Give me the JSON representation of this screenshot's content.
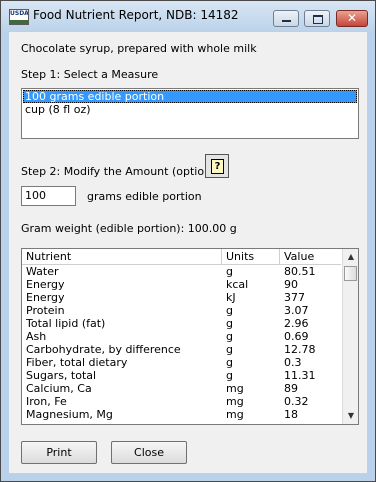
{
  "window": {
    "title": "Food Nutrient Report, NDB: 14182",
    "icon_label": "USDA",
    "controls": {
      "minimize_icon": "minimize-icon",
      "maximize_icon": "maximize-icon",
      "close_glyph": "✕"
    }
  },
  "food_description": "Chocolate syrup, prepared with whole milk",
  "step1": {
    "label": "Step 1: Select a Measure",
    "measures": [
      {
        "label": "100 grams edible portion",
        "selected": true
      },
      {
        "label": "cup (8 fl oz)",
        "selected": false
      }
    ]
  },
  "step2": {
    "label": "Step 2: Modify the Amount (optional)",
    "help_glyph": "?",
    "amount_value": "100",
    "unit_label": "grams edible portion"
  },
  "gram_weight": "Gram weight (edible portion): 100.00 g",
  "table": {
    "headers": [
      "Nutrient",
      "Units",
      "Value"
    ],
    "rows": [
      [
        "Water",
        "g",
        "80.51"
      ],
      [
        "Energy",
        "kcal",
        "90"
      ],
      [
        "Energy",
        "kJ",
        "377"
      ],
      [
        "Protein",
        "g",
        "3.07"
      ],
      [
        "Total lipid (fat)",
        "g",
        "2.96"
      ],
      [
        "Ash",
        "g",
        "0.69"
      ],
      [
        "Carbohydrate, by difference",
        "g",
        "12.78"
      ],
      [
        "Fiber, total dietary",
        "g",
        "0.3"
      ],
      [
        "Sugars, total",
        "g",
        "11.31"
      ],
      [
        "Calcium, Ca",
        "mg",
        "89"
      ],
      [
        "Iron, Fe",
        "mg",
        "0.32"
      ],
      [
        "Magnesium, Mg",
        "mg",
        "18"
      ]
    ]
  },
  "buttons": {
    "print": "Print",
    "close": "Close"
  }
}
